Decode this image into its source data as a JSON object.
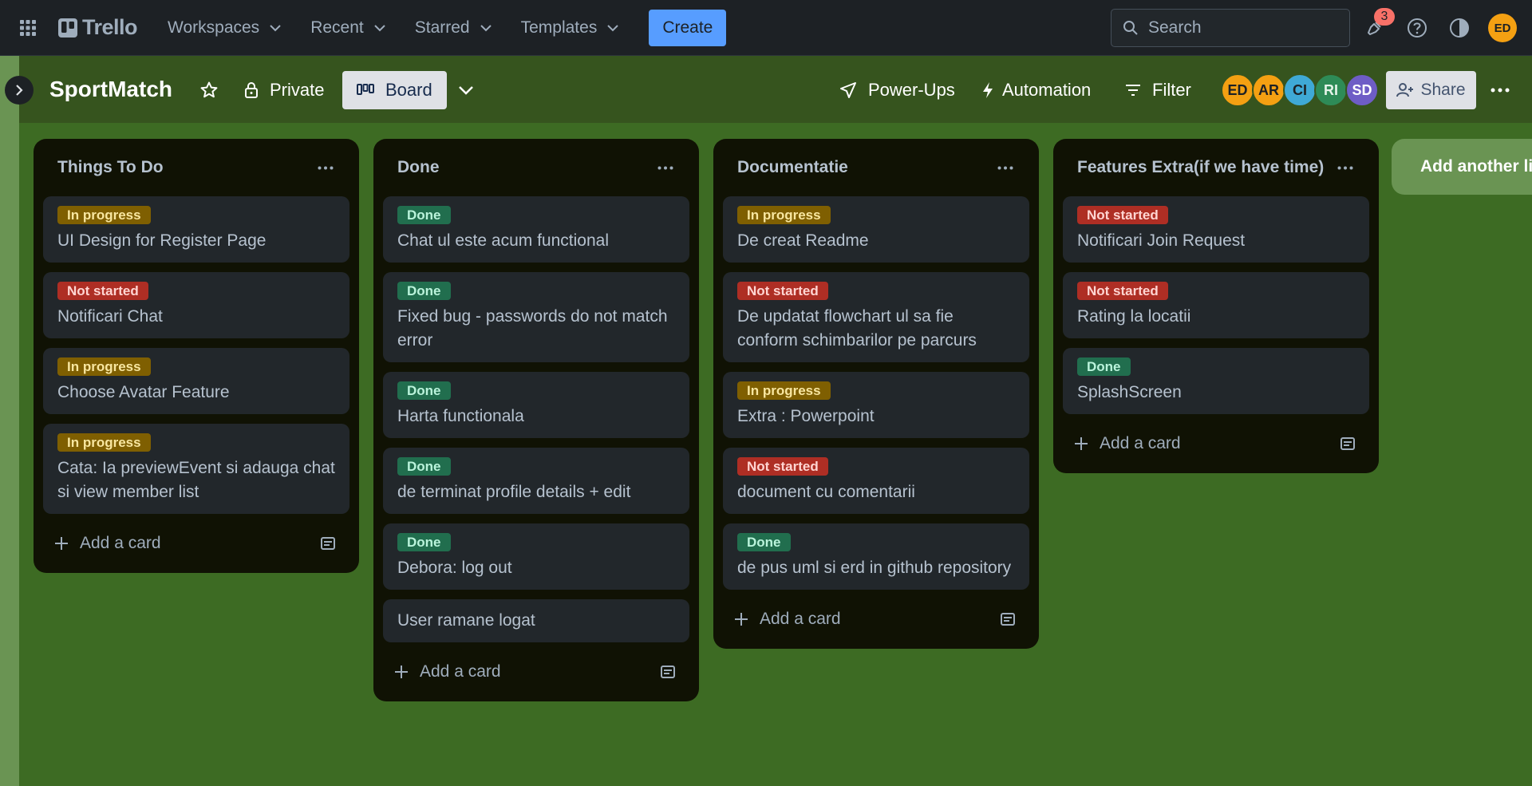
{
  "nav": {
    "logo": "Trello",
    "workspaces": "Workspaces",
    "recent": "Recent",
    "starred": "Starred",
    "templates": "Templates",
    "create": "Create",
    "search_placeholder": "Search",
    "notifications_count": "3",
    "user_initials": "ED"
  },
  "board": {
    "title": "SportMatch",
    "visibility": "Private",
    "view": "Board",
    "powerups": "Power-Ups",
    "automation": "Automation",
    "filter": "Filter",
    "share": "Share",
    "members": [
      {
        "initials": "ED",
        "color": "#f4a012"
      },
      {
        "initials": "AR",
        "color": "#f4a012"
      },
      {
        "initials": "CI",
        "color": "#3fa9d6"
      },
      {
        "initials": "RI",
        "color": "#2e8b57"
      },
      {
        "initials": "SD",
        "color": "#6e5dc6"
      }
    ]
  },
  "lists": [
    {
      "title": "Things To Do",
      "add_card": "Add a card",
      "cards": [
        {
          "label": "In progress",
          "title": "UI Design for Register Page"
        },
        {
          "label": "Not started",
          "title": "Notificari Chat"
        },
        {
          "label": "In progress",
          "title": "Choose Avatar Feature"
        },
        {
          "label": "In progress",
          "title": "Cata: Ia previewEvent si adauga chat si view member list"
        }
      ]
    },
    {
      "title": "Done",
      "add_card": "Add a card",
      "cards": [
        {
          "label": "Done",
          "title": "Chat ul este acum functional"
        },
        {
          "label": "Done",
          "title": "Fixed bug - passwords do not match error"
        },
        {
          "label": "Done",
          "title": "Harta functionala"
        },
        {
          "label": "Done",
          "title": "de terminat profile details + edit"
        },
        {
          "label": "Done",
          "title": "Debora: log out"
        },
        {
          "label": "",
          "title": "User ramane logat"
        }
      ]
    },
    {
      "title": "Documentatie",
      "add_card": "Add a card",
      "cards": [
        {
          "label": "In progress",
          "title": "De creat Readme"
        },
        {
          "label": "Not started",
          "title": "De updatat flowchart ul sa fie conform schimbarilor pe parcurs"
        },
        {
          "label": "In progress",
          "title": "Extra : Powerpoint"
        },
        {
          "label": "Not started",
          "title": "document cu comentarii"
        },
        {
          "label": "Done",
          "title": "de pus uml si erd in github repository"
        }
      ]
    },
    {
      "title": "Features Extra(if we have time)",
      "add_card": "Add a card",
      "cards": [
        {
          "label": "Not started",
          "title": "Notificari Join Request"
        },
        {
          "label": "Not started",
          "title": "Rating la locatii"
        },
        {
          "label": "Done",
          "title": "SplashScreen"
        }
      ]
    }
  ],
  "add_list": "Add another list",
  "colors": {
    "board_bg": "#3d6b23",
    "label_in_progress": "#7f5f01",
    "label_not_started": "#ae2e24",
    "label_done": "#216e4e"
  }
}
